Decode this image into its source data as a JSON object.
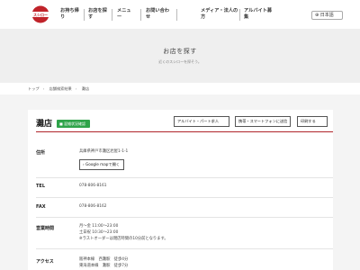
{
  "header": {
    "logo_text": "スシロー",
    "nav": [
      {
        "label_1": "お持ち帰",
        "label_2": "り"
      },
      {
        "label_1": "お店を探",
        "label_2": "す"
      },
      {
        "label_1": "メニュ",
        "label_2": "ー"
      },
      {
        "label_1": "お問い合わ",
        "label_2": "せ"
      },
      {
        "label_1": "メディア・法人の",
        "label_2": "方"
      },
      {
        "label_1": "アルバイト募",
        "label_2": "集"
      }
    ],
    "lang_label": "日本語"
  },
  "hero": {
    "title": "お店を探す",
    "subtitle": "近くのスシローを探そう。"
  },
  "breadcrumb": [
    "トップ",
    "店舗検索結果",
    "灘店"
  ],
  "store": {
    "name": "灘店",
    "badge": "■ 混雑状況確認",
    "actions": [
      "アルバイト・パート求人",
      "携帯・スマートフォンに送信",
      "印刷する"
    ],
    "map_button": "Google mapで開く",
    "rows": {
      "address_label": "住所",
      "address": "兵庫県神戸市灘区岩屋1-1-1",
      "tel_label": "TEL",
      "tel": "078-806-8161",
      "fax_label": "FAX",
      "fax": "078-806-8162",
      "hours_label": "営業時間",
      "hours": [
        "月～金 11:00～23:00",
        "土日祝 10:30～23:00",
        "※ラストオーダーは閉店時間の10分前となります。"
      ],
      "access_label": "アクセス",
      "access": [
        "阪神本線　西灘駅　徒歩4分",
        "東海道本線　灘駅　徒歩7分"
      ]
    }
  }
}
